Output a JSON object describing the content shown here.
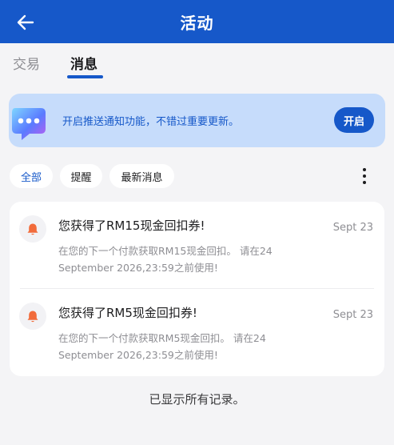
{
  "header": {
    "title": "活动",
    "back_icon": "arrow-left-icon"
  },
  "tabs": [
    {
      "label": "交易",
      "active": false
    },
    {
      "label": "消息",
      "active": true
    }
  ],
  "banner": {
    "icon": "chat-bubble-icon",
    "text": "开启推送通知功能，不错过重要更新。",
    "button_label": "开启"
  },
  "filters": {
    "chips": [
      {
        "label": "全部",
        "active": true
      },
      {
        "label": "提醒",
        "active": false
      },
      {
        "label": "最新消息",
        "active": false
      }
    ],
    "more_icon": "more-vertical-icon"
  },
  "messages": [
    {
      "icon": "bell-icon",
      "title": "您获得了RM15现金回扣券!",
      "date": "Sept 23",
      "body_line1": "在您的下一个付款获取RM15现金回扣。 请在24",
      "body_line2": "September 2026,23:59之前使用!"
    },
    {
      "icon": "bell-icon",
      "title": "您获得了RM5现金回扣券!",
      "date": "Sept 23",
      "body_line1": "在您的下一个付款获取RM5现金回扣。 请在24",
      "body_line2": "September 2026,23:59之前使用!"
    }
  ],
  "footer_note": "已显示所有记录。",
  "colors": {
    "primary": "#1658c9",
    "banner_bg": "#c6dcfb",
    "bell": "#f26b3a",
    "background": "#f4f4f6"
  }
}
